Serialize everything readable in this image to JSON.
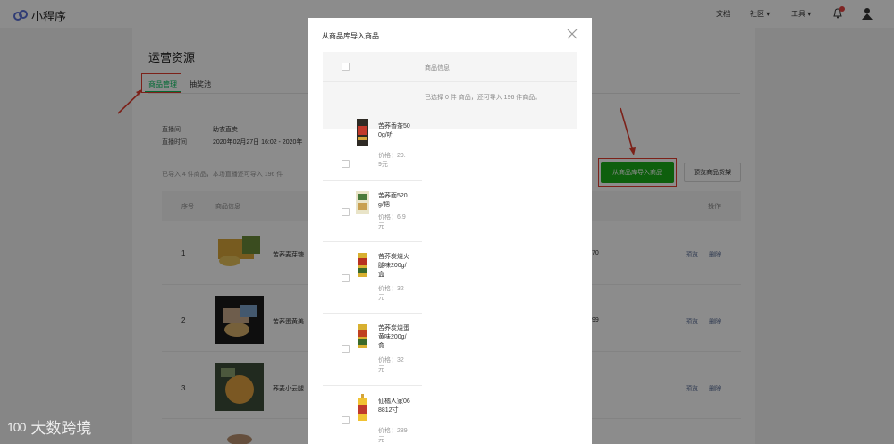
{
  "app": {
    "logo_text": "小程序"
  },
  "nav": {
    "docs": "文档",
    "community": "社区",
    "tools": "工具"
  },
  "page": {
    "title": "运营资源",
    "tabs": [
      {
        "label": "商品管理"
      },
      {
        "label": "抽奖池"
      }
    ],
    "room_label": "直播间",
    "room_value": "助农直卖",
    "time_label": "直播时间",
    "time_value": "2020年02月27日 16:02 - 2020年",
    "import_note": "已导入 4 件商品，本场直播还可导入 196 件",
    "import_button": "从商品库导入商品",
    "preview_button": "预览商品货架"
  },
  "table": {
    "headers": {
      "seq": "序号",
      "info": "商品信息",
      "op": "操作"
    },
    "rows": [
      {
        "seq": "1",
        "name": "苦荞麦芽糖",
        "tail": "70",
        "preview": "预览",
        "delete": "删除"
      },
      {
        "seq": "2",
        "name": "苦荞蛋黄美",
        "tail": "99",
        "preview": "预览",
        "delete": "删除"
      },
      {
        "seq": "3",
        "name": "荞麦小云腿",
        "tail": "",
        "preview": "预览",
        "delete": "删除"
      }
    ]
  },
  "modal": {
    "title": "从商品库导入商品",
    "column_header": "商品信息",
    "count_note": "已选择 0 件 商品，还可导入 196 件商品。",
    "items": [
      {
        "name": "苦荞香茶500g/听",
        "price": "价格：29.9元"
      },
      {
        "name": "苦荞面520g/把",
        "price": "价格：6.9元"
      },
      {
        "name": "苦荞炭烧火腿味200g/盒",
        "price": "价格：32元"
      },
      {
        "name": "苦荞炭烧蛋黄味200g/盒",
        "price": "价格：32元"
      },
      {
        "name": "仙橘人家068812寸",
        "price": "价格：289元"
      }
    ]
  },
  "watermark": {
    "logo": "100",
    "text": "大数跨境"
  },
  "colors": {
    "accent_green": "#1aad19",
    "annotation_red": "#e23c2f",
    "link_blue": "#576b95"
  }
}
